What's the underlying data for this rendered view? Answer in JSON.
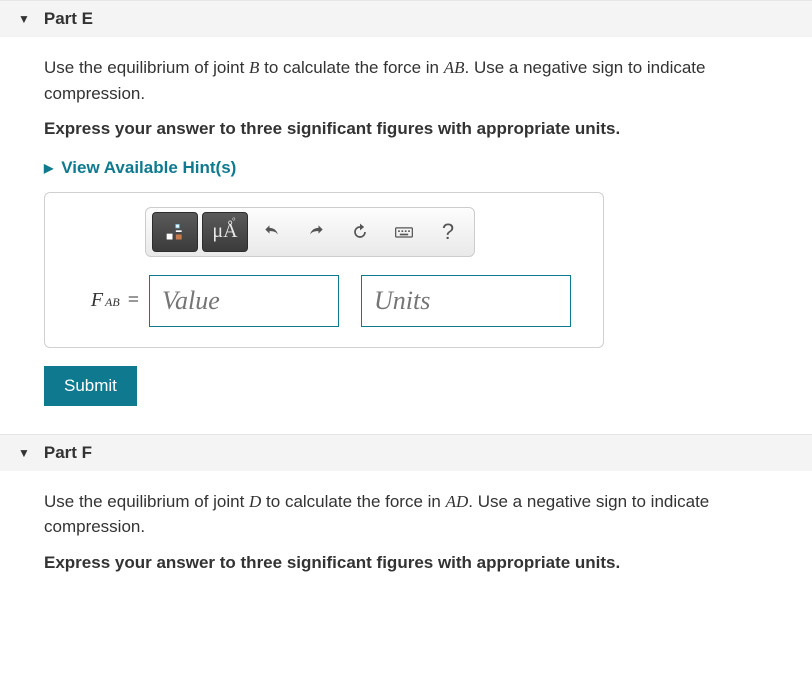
{
  "parts": {
    "e": {
      "label": "Part E",
      "prompt_pre": "Use the equilibrium of joint ",
      "prompt_joint": "B",
      "prompt_mid": " to calculate the force in ",
      "prompt_member": "AB",
      "prompt_post": ". Use a negative sign to indicate compression.",
      "instruction": "Express your answer to three significant figures with appropriate units.",
      "hints_label": "View Available Hint(s)",
      "variable_main": "F",
      "variable_sub": "AB",
      "equals": " =",
      "value_placeholder": "Value",
      "units_placeholder": "Units",
      "submit_label": "Submit"
    },
    "f": {
      "label": "Part F",
      "prompt_pre": "Use the equilibrium of joint ",
      "prompt_joint": "D",
      "prompt_mid": " to calculate the force in ",
      "prompt_member": "AD",
      "prompt_post": ". Use a negative sign to indicate compression.",
      "instruction": "Express your answer to three significant figures with appropriate units."
    }
  },
  "toolbar": {
    "templates_label": "templates",
    "special_chars_label": "μÅ",
    "help_glyph": "?"
  }
}
